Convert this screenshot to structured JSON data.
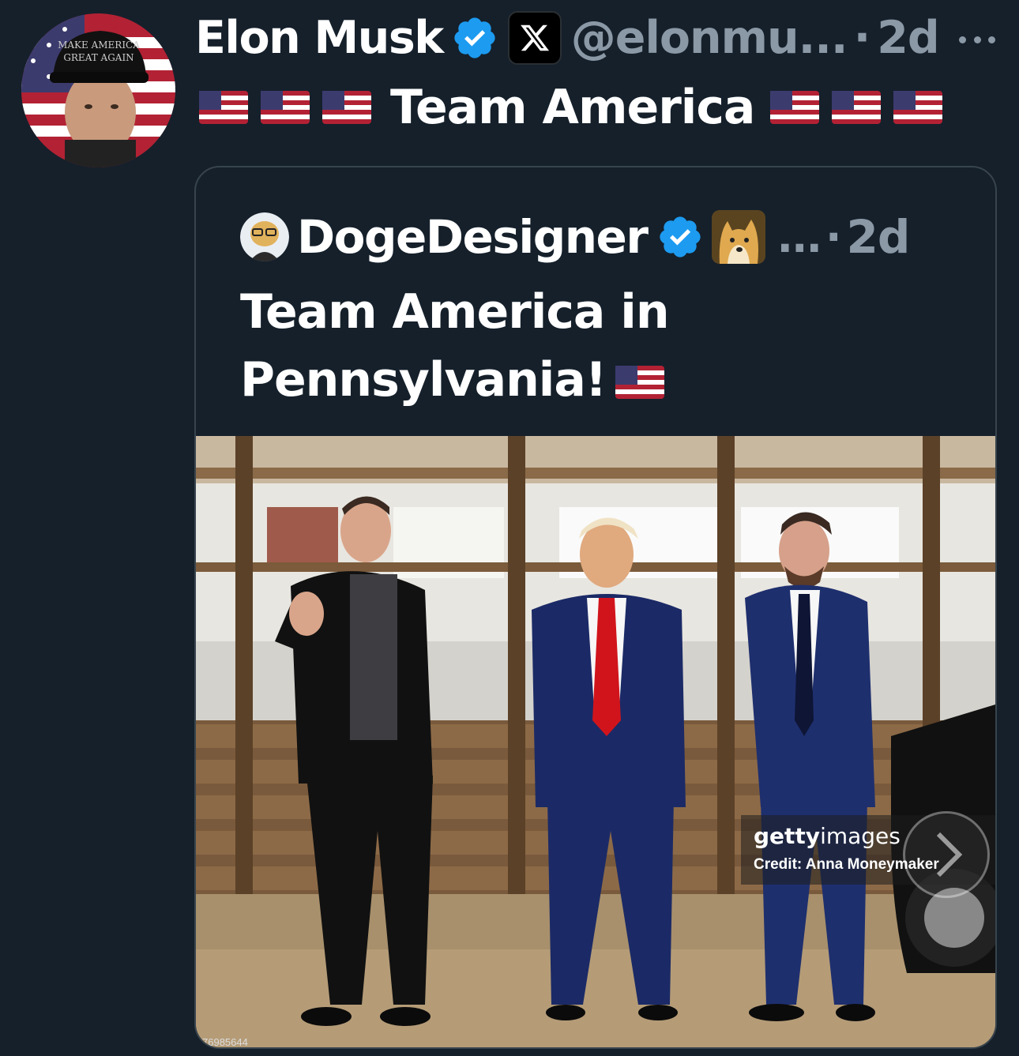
{
  "tweet": {
    "author_name": "Elon Musk",
    "handle": "@elonmu...",
    "separator": "·",
    "time": "2d",
    "text": "Team America",
    "avatar_hat_text": "MAKE AMERICA GREAT AGAIN"
  },
  "quote": {
    "author_name": "DogeDesigner",
    "ellipsis": "...",
    "separator": "·",
    "time": "2d",
    "text": "Team America in Pennsylvania!"
  },
  "media": {
    "getty_logo_bold": "getty",
    "getty_logo_light": "images",
    "credit": "Credit: Anna Moneymaker",
    "image_id": "76985644"
  },
  "colors": {
    "background": "#15202b",
    "secondary_text": "#8b98a5",
    "verified_blue": "#1d9bf0",
    "card_border": "#38444d"
  }
}
